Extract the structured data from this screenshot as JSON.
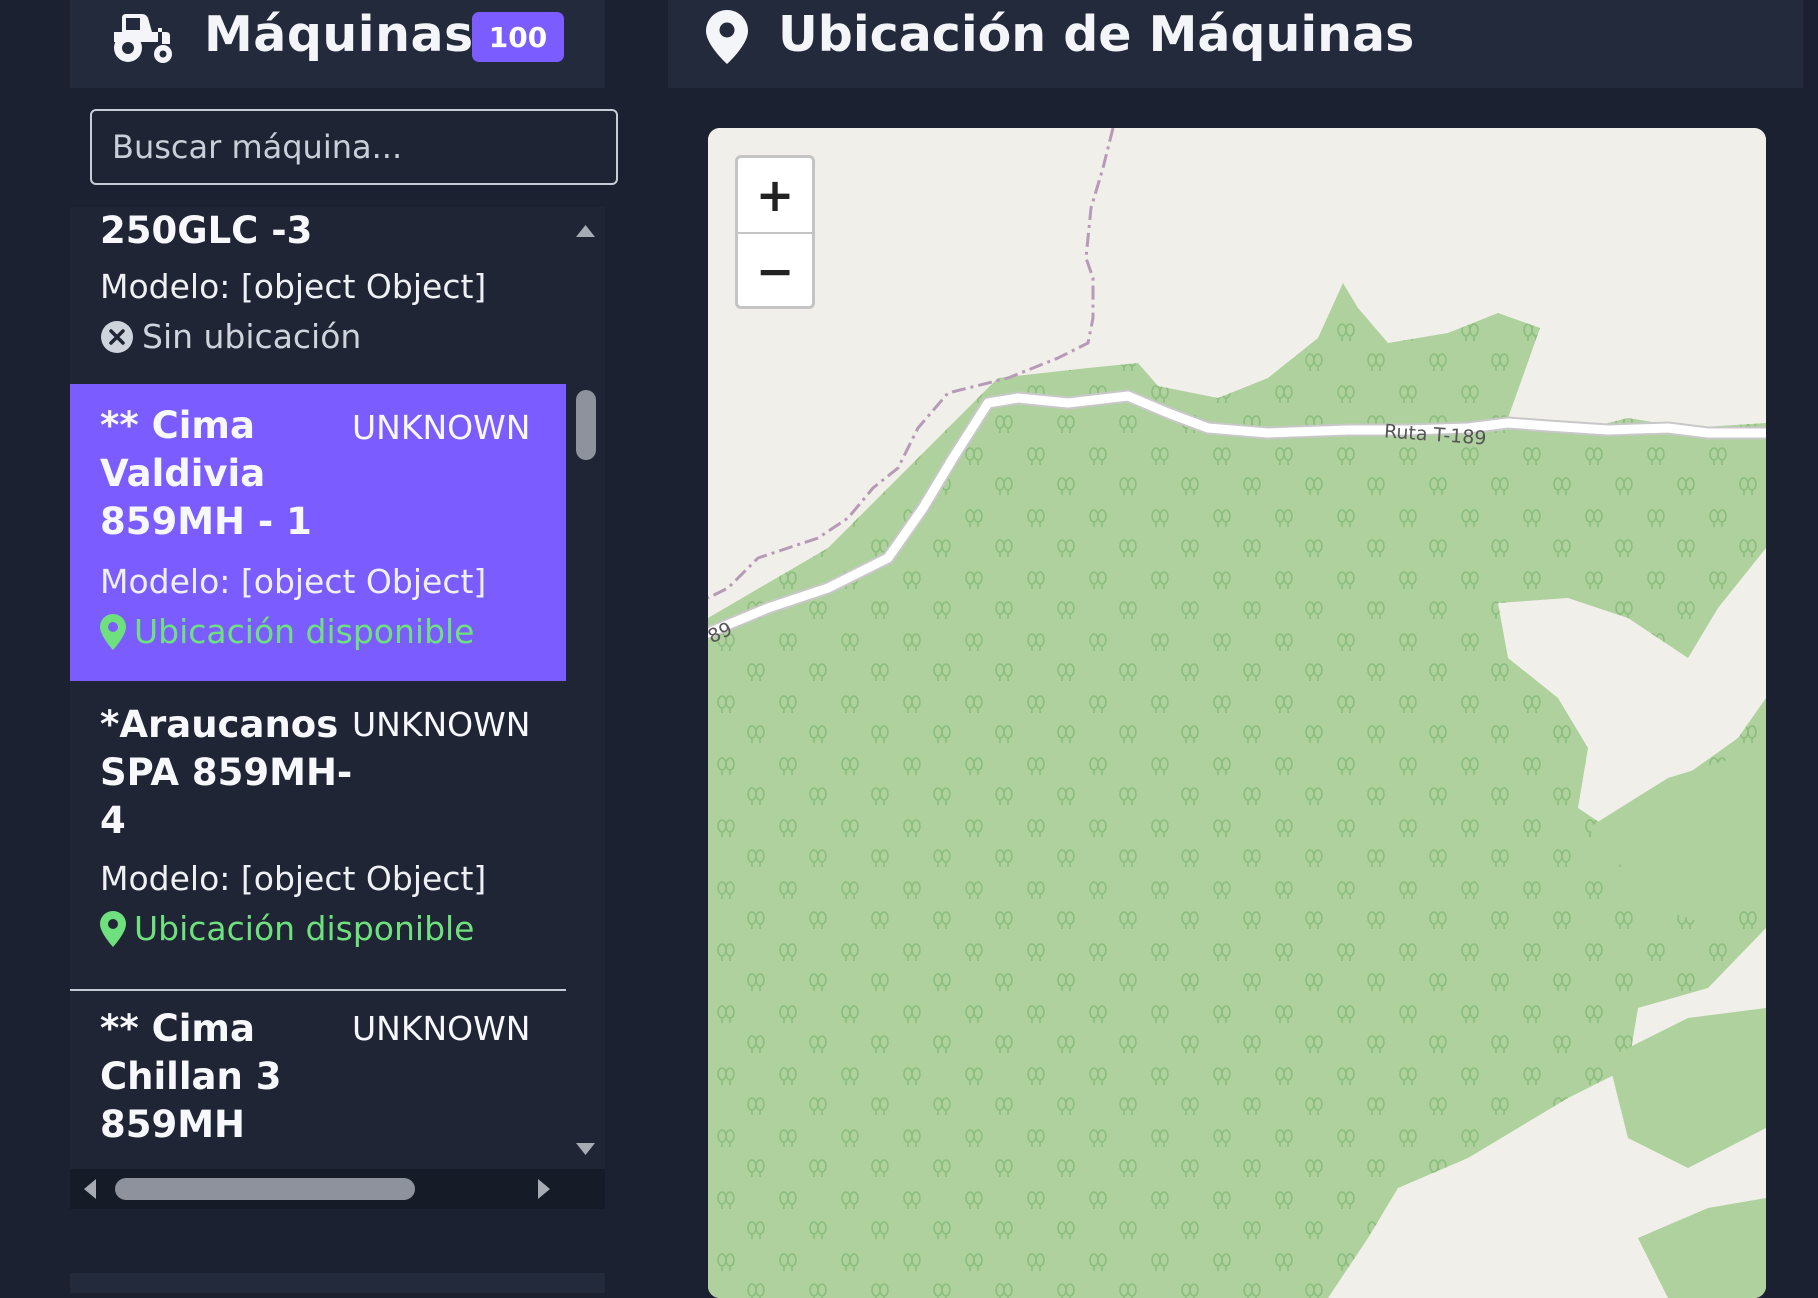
{
  "left_panel": {
    "title": "Máquinas",
    "count": "100",
    "search_placeholder": "Buscar máquina..."
  },
  "machines": [
    {
      "name": "250GLC -3",
      "status": "",
      "model": "Modelo: [object Object]",
      "location": "Sin ubicación",
      "has_location": false,
      "selected": false
    },
    {
      "name": "** Cima Valdivia 859MH - 1",
      "status": "UNKNOWN",
      "model": "Modelo: [object Object]",
      "location": "Ubicación disponible",
      "has_location": true,
      "selected": true
    },
    {
      "name": "*Araucanos SPA 859MH-4",
      "status": "UNKNOWN",
      "model": "Modelo: [object Object]",
      "location": "Ubicación disponible",
      "has_location": true,
      "selected": false
    },
    {
      "name": "** Cima Chillan 3 859MH",
      "status": "UNKNOWN",
      "model": "",
      "location": "",
      "has_location": null,
      "selected": false
    }
  ],
  "name_lines": {
    "m0": [
      "250GLC -3"
    ],
    "m1": [
      "** Cima",
      "Valdivia",
      "859MH - 1"
    ],
    "m2": [
      "*Araucanos",
      "SPA 859MH-",
      "4"
    ],
    "m3": [
      "** Cima",
      "Chillan 3",
      "859MH"
    ]
  },
  "right_panel": {
    "title": "Ubicación de Máquinas"
  },
  "map": {
    "zoom_in": "+",
    "zoom_out": "−",
    "road_label": "Ruta T-189",
    "road_label_edge": "89"
  },
  "colors": {
    "accent": "#7b5cff",
    "location_ok": "#6fe07e",
    "forest": "#aed19d",
    "land": "#f1efe9",
    "tree_symbol": "#8bbd7d"
  },
  "icons": {
    "header_left": "tractor-icon",
    "header_right": "map-pin-icon",
    "location_ok": "map-pin-icon",
    "location_none": "x-circle-icon"
  }
}
